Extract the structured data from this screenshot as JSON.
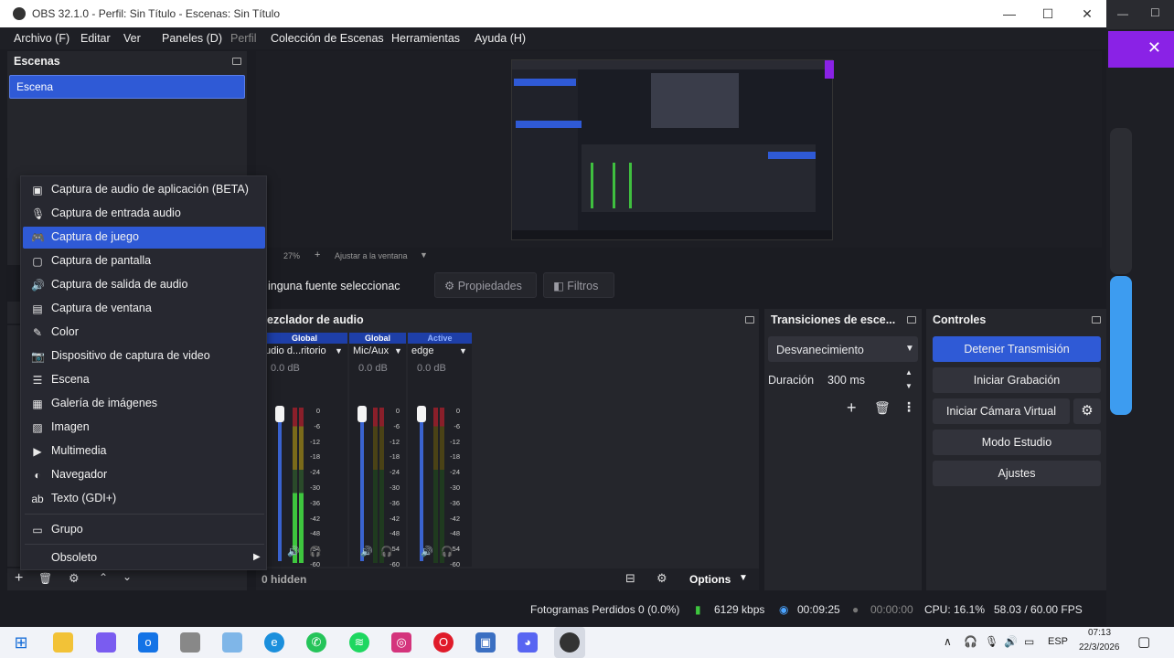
{
  "window": {
    "title": "OBS 32.1.0 - Perfil: Sin Título - Escenas: Sin Título",
    "minimize": "—",
    "maximize": "☐",
    "close": "✕"
  },
  "menubar": [
    "Archivo (F)",
    "Editar",
    "Ver",
    "Paneles (D)",
    "Perfil",
    "Colección de Escenas",
    "Herramientas",
    "Ayuda (H)"
  ],
  "scenes": {
    "title": "Escenas",
    "items": [
      "Escena"
    ]
  },
  "preview": {
    "zoom": "27%",
    "fit": "Ajustar a la ventana"
  },
  "sources_bar": {
    "no_source": "inguna fuente seleccionac",
    "properties": "Propiedades",
    "filters": "Filtros"
  },
  "context_menu": {
    "items": [
      {
        "label": "Captura de audio de aplicación (BETA)",
        "icon": "app-audio-icon"
      },
      {
        "label": "Captura de entrada audio",
        "icon": "microphone-icon"
      },
      {
        "label": "Captura de juego",
        "icon": "gamepad-icon",
        "selected": true
      },
      {
        "label": "Captura de pantalla",
        "icon": "monitor-icon"
      },
      {
        "label": "Captura de salida de audio",
        "icon": "speaker-icon"
      },
      {
        "label": "Captura de ventana",
        "icon": "window-icon"
      },
      {
        "label": "Color",
        "icon": "brush-icon"
      },
      {
        "label": "Dispositivo de captura de video",
        "icon": "camera-icon"
      },
      {
        "label": "Escena",
        "icon": "list-icon"
      },
      {
        "label": "Galería de imágenes",
        "icon": "gallery-icon"
      },
      {
        "label": "Imagen",
        "icon": "image-icon"
      },
      {
        "label": "Multimedia",
        "icon": "play-icon"
      },
      {
        "label": "Navegador",
        "icon": "globe-icon"
      },
      {
        "label": "Texto (GDI+)",
        "icon": "text-icon"
      },
      {
        "label": "Grupo",
        "icon": "folder-icon"
      },
      {
        "label": "Obsoleto",
        "icon": "submenu-arrow-icon"
      }
    ]
  },
  "mixer": {
    "title": "ezclador de audio",
    "channels": [
      {
        "tag": "Global",
        "name": "udio d...ritorio",
        "db": "0.0 dB",
        "color": "#1e3fa8"
      },
      {
        "tag": "Global",
        "name": "Mic/Aux",
        "db": "0.0 dB",
        "color": "#1e3fa8"
      },
      {
        "tag": "Active",
        "name": "edge",
        "db": "0.0 dB",
        "color": "#1e3fa8"
      }
    ],
    "scale": [
      "0",
      "-6",
      "-12",
      "-18",
      "-24",
      "-30",
      "-36",
      "-42",
      "-48",
      "-54",
      "-60"
    ],
    "hidden": "0 hidden",
    "options": "Options"
  },
  "transitions": {
    "title": "Transiciones de esce...",
    "type": "Desvanecimiento",
    "duration_label": "Duración",
    "duration": "300 ms"
  },
  "controls": {
    "title": "Controles",
    "stop_stream": "Detener Transmisión",
    "start_rec": "Iniciar Grabación",
    "virtual_cam": "Iniciar Cámara Virtual",
    "studio": "Modo Estudio",
    "settings": "Ajustes"
  },
  "status": {
    "dropped": "Fotogramas Perdidos 0 (0.0%)",
    "bitrate": "6129 kbps",
    "stream_time": "00:09:25",
    "rec_time": "00:00:00",
    "cpu": "CPU: 16.1%",
    "fps": "58.03 / 60.00 FPS"
  },
  "taskbar": {
    "lang": "ESP",
    "time": "07:13",
    "date": "22/3/2026"
  },
  "colors": {
    "accent": "#2f5ad6",
    "panel": "#25262c",
    "bg": "#1b1c22"
  }
}
